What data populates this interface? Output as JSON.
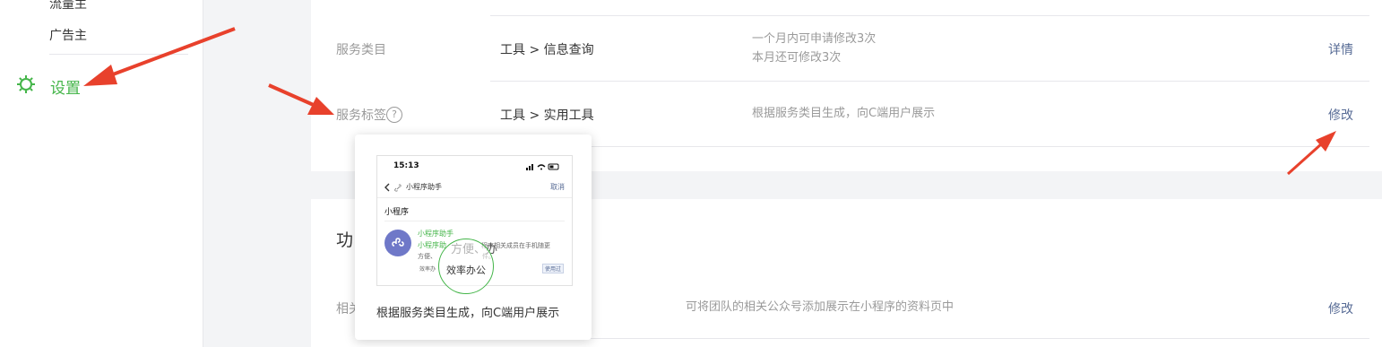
{
  "sidebar": {
    "items": [
      {
        "label": "流量主"
      },
      {
        "label": "广告主"
      }
    ],
    "settings": {
      "label": "设置",
      "icon": "gear-icon",
      "color": "#44b549"
    }
  },
  "service_info": {
    "rows": [
      {
        "label": "服务类目",
        "value": "工具 > 信息查询",
        "note_line1": "一个月内可申请修改3次",
        "note_line2": "本月还可修改3次",
        "action": "详情"
      },
      {
        "label": "服务标签",
        "help_icon": "?",
        "value": "工具 > 实用工具",
        "note": "根据服务类目生成，向C端用户展示",
        "action": "修改"
      }
    ]
  },
  "section2": {
    "title_visible": "功",
    "row": {
      "label_visible": "相关",
      "note": "可将团队的相关公众号添加展示在小程序的资料页中",
      "action": "修改"
    }
  },
  "tooltip": {
    "caption": "根据服务类目生成，向C端用户展示",
    "phone": {
      "time": "15:13",
      "title": "小程序助手",
      "cancel": "取消",
      "tab": "小程序",
      "result_name": "小程序助手",
      "result_desc1": "小程序助",
      "result_desc1b": "程序相关成员在手机随更",
      "result_desc2": "方便、",
      "result_desc2b": "件。",
      "tag_small": "效率办",
      "badge": "使用过",
      "overlay_big": "方便、办",
      "highlight_tag": "效率办公"
    }
  },
  "colors": {
    "accent": "#44b549",
    "link": "#576b95",
    "arrow": "#e8412c"
  }
}
